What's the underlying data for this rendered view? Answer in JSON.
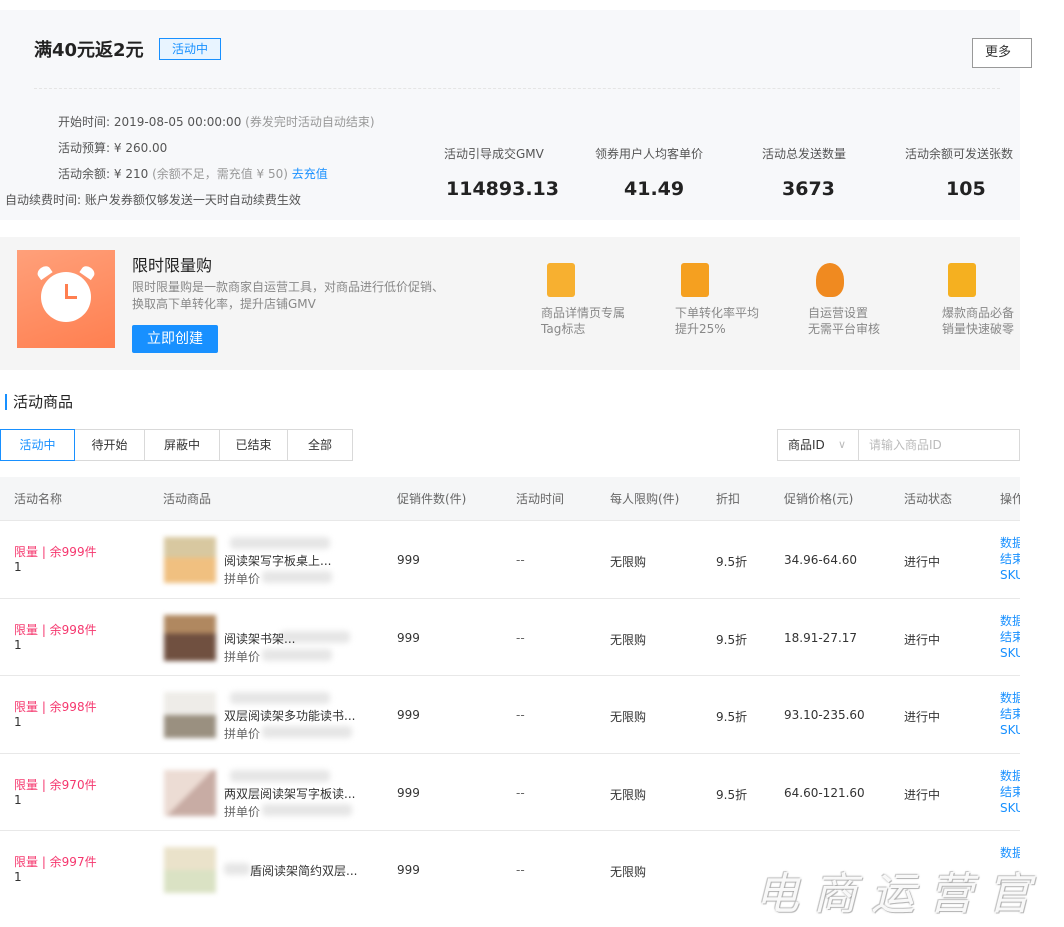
{
  "campaign": {
    "title": "满40元返2元",
    "status_badge": "活动中",
    "more_button": "更多",
    "info": {
      "start_label": "开始时间:",
      "start_value": "2019-08-05 00:00:00",
      "start_note": "(券发完时活动自动结束)",
      "budget_label": "活动预算:",
      "budget_value": "¥ 260.00",
      "balance_label": "活动余额:",
      "balance_value": "¥ 210",
      "balance_note": "(余额不足，需充值 ¥ 50)",
      "recharge_link": "去充值",
      "renew_label": "自动续费时间:",
      "renew_value": "账户发券额仅够发送一天时自动续费生效"
    },
    "stats": [
      {
        "label": "活动引导成交GMV",
        "value": "114893.13"
      },
      {
        "label": "领券用户人均客单价",
        "value": "41.49"
      },
      {
        "label": "活动总发送数量",
        "value": "3673"
      },
      {
        "label": "活动余额可发送张数",
        "value": "105"
      }
    ]
  },
  "promo": {
    "title": "限时限量购",
    "description": "限时限量购是一款商家自运营工具，对商品进行低价促销、换取高下单转化率，提升店铺GMV",
    "button": "立即创建",
    "features": [
      {
        "icon": "tag-icon",
        "line1": "商品详情页专属",
        "line2": "Tag标志",
        "color": "#f7b030"
      },
      {
        "icon": "chart-icon",
        "line1": "下单转化率平均",
        "line2": "提升25%",
        "color": "#f5a020"
      },
      {
        "icon": "money-bag-icon",
        "line1": "自运营设置",
        "line2": "无需平台审核",
        "color": "#f08a20"
      },
      {
        "icon": "hot-item-icon",
        "line1": "爆款商品必备",
        "line2": "销量快速破零",
        "color": "#f5b020"
      }
    ]
  },
  "section": {
    "title": "活动商品"
  },
  "tabs": [
    {
      "label": "活动中",
      "active": true
    },
    {
      "label": "待开始",
      "active": false
    },
    {
      "label": "屏蔽中",
      "active": false
    },
    {
      "label": "已结束",
      "active": false
    },
    {
      "label": "全部",
      "active": false
    }
  ],
  "filter": {
    "select_value": "商品ID",
    "input_placeholder": "请输入商品ID"
  },
  "table": {
    "columns": [
      "活动名称",
      "活动商品",
      "促销件数(件)",
      "活动时间",
      "每人限购(件)",
      "折扣",
      "促销价格(元)",
      "活动状态",
      "操作"
    ],
    "rows": [
      {
        "name": "限量 | 余999件",
        "sub": "1",
        "product": "阅读架写字板桌上...",
        "group_price": "拼单价",
        "qty": "999",
        "time": "--",
        "limit": "无限购",
        "discount": "9.5折",
        "price": "34.96-64.60",
        "status": "进行中",
        "ops": [
          "数据",
          "结束",
          "SKU"
        ],
        "thumb_a": "#d8c8a0",
        "thumb_b": "#f0c080"
      },
      {
        "name": "限量 | 余998件",
        "sub": "1",
        "product": "阅读架书架...",
        "group_price": "拼单价",
        "qty": "999",
        "time": "--",
        "limit": "无限购",
        "discount": "9.5折",
        "price": "18.91-27.17",
        "status": "进行中",
        "ops": [
          "数据",
          "结束",
          "SKU"
        ],
        "thumb_a": "#a07850",
        "thumb_b": "#705040"
      },
      {
        "name": "限量 | 余998件",
        "sub": "1",
        "product": "双层阅读架多功能读书...",
        "group_price": "拼单价",
        "qty": "999",
        "time": "--",
        "limit": "无限购",
        "discount": "9.5折",
        "price": "93.10-235.60",
        "status": "进行中",
        "ops": [
          "数据",
          "结束",
          "SKU"
        ],
        "thumb_a": "#e0ddd8",
        "thumb_b": "#888070"
      },
      {
        "name": "限量 | 余970件",
        "sub": "1",
        "product": "两双层阅读架写字板读...",
        "group_price": "拼单价",
        "qty": "999",
        "time": "--",
        "limit": "无限购",
        "discount": "9.5折",
        "price": "64.60-121.60",
        "status": "进行中",
        "ops": [
          "数据",
          "结束",
          "SKU"
        ],
        "thumb_a": "#e8d8d0",
        "thumb_b": "#c0a8a0"
      },
      {
        "name": "限量 | 余997件",
        "sub": "1",
        "product": "盾阅读架简约双层...",
        "group_price": "",
        "qty": "999",
        "time": "--",
        "limit": "无限购",
        "discount": "",
        "price": "",
        "status": "",
        "ops": [
          "数据"
        ],
        "thumb_a": "#e8e0c8",
        "thumb_b": "#d8e0c0"
      }
    ]
  },
  "watermark": "电商运营官"
}
